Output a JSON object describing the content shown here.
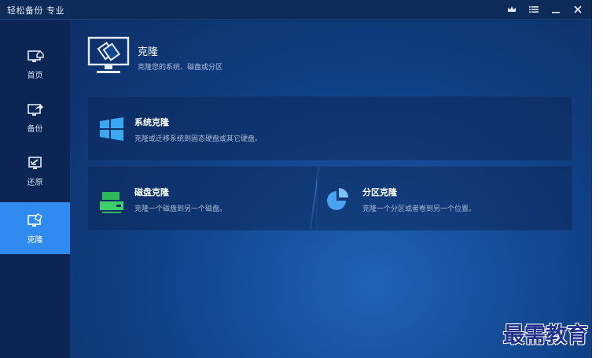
{
  "app": {
    "title": "轻松备份 专业"
  },
  "window_controls": {
    "upgrade_icon": "crown-icon",
    "menu_icon": "menu-icon",
    "minimize_icon": "minimize-icon",
    "close_icon": "close-icon"
  },
  "sidebar": {
    "items": [
      {
        "label": "首页",
        "icon": "home-monitor-icon",
        "active": false
      },
      {
        "label": "备份",
        "icon": "backup-monitor-icon",
        "active": false
      },
      {
        "label": "还原",
        "icon": "restore-monitor-icon",
        "active": false
      },
      {
        "label": "克隆",
        "icon": "clone-monitor-icon",
        "active": true
      }
    ]
  },
  "header": {
    "title": "克隆",
    "subtitle": "克隆您的系统、磁盘或分区",
    "icon": "clone-monitor-icon"
  },
  "cards": {
    "system_clone": {
      "title": "系统克隆",
      "description": "克隆或迁移系统到固态硬盘或其它硬盘。",
      "icon": "windows-logo-icon"
    },
    "disk_clone": {
      "title": "磁盘克隆",
      "description": "克隆一个磁盘到另一个磁盘。",
      "icon": "disk-drive-icon"
    },
    "partition_clone": {
      "title": "分区克隆",
      "description": "克隆一个分区或者卷到另一个位置。",
      "icon": "pie-partition-icon"
    }
  },
  "watermark": {
    "text": "最需教育"
  },
  "colors": {
    "accent": "#2f8bf0",
    "sidebar_bg": "#0b2654",
    "disk_icon": "#3fcf6a",
    "windows_icon": "#3aa8f0"
  }
}
